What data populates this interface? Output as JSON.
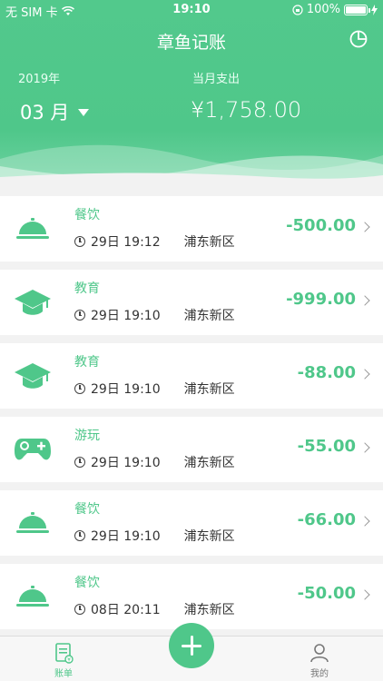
{
  "status_bar": {
    "carrier": "无 SIM 卡",
    "time": "19:10",
    "battery": "100%"
  },
  "header": {
    "title": "章鱼记账",
    "year": "2019年",
    "month": "03 月",
    "expense_label": "当月支出",
    "expense_total": "¥1,758.00",
    "pie_icon": "pie-chart-icon"
  },
  "entries": [
    {
      "category": "餐饮",
      "icon": "food-cloche-icon",
      "time": "29日 19:12",
      "place": "浦东新区",
      "amount": "-500.00"
    },
    {
      "category": "教育",
      "icon": "graduation-cap-icon",
      "time": "29日 19:10",
      "place": "浦东新区",
      "amount": "-999.00"
    },
    {
      "category": "教育",
      "icon": "graduation-cap-icon",
      "time": "29日 19:10",
      "place": "浦东新区",
      "amount": "-88.00"
    },
    {
      "category": "游玩",
      "icon": "gamepad-icon",
      "time": "29日 19:10",
      "place": "浦东新区",
      "amount": "-55.00"
    },
    {
      "category": "餐饮",
      "icon": "food-cloche-icon",
      "time": "29日 19:10",
      "place": "浦东新区",
      "amount": "-66.00"
    },
    {
      "category": "餐饮",
      "icon": "food-cloche-icon",
      "time": "08日 20:11",
      "place": "浦东新区",
      "amount": "-50.00"
    }
  ],
  "tabbar": {
    "bills_label": "账单",
    "me_label": "我的"
  },
  "colors": {
    "accent": "#4fc78a",
    "background": "#f2f2f2"
  }
}
